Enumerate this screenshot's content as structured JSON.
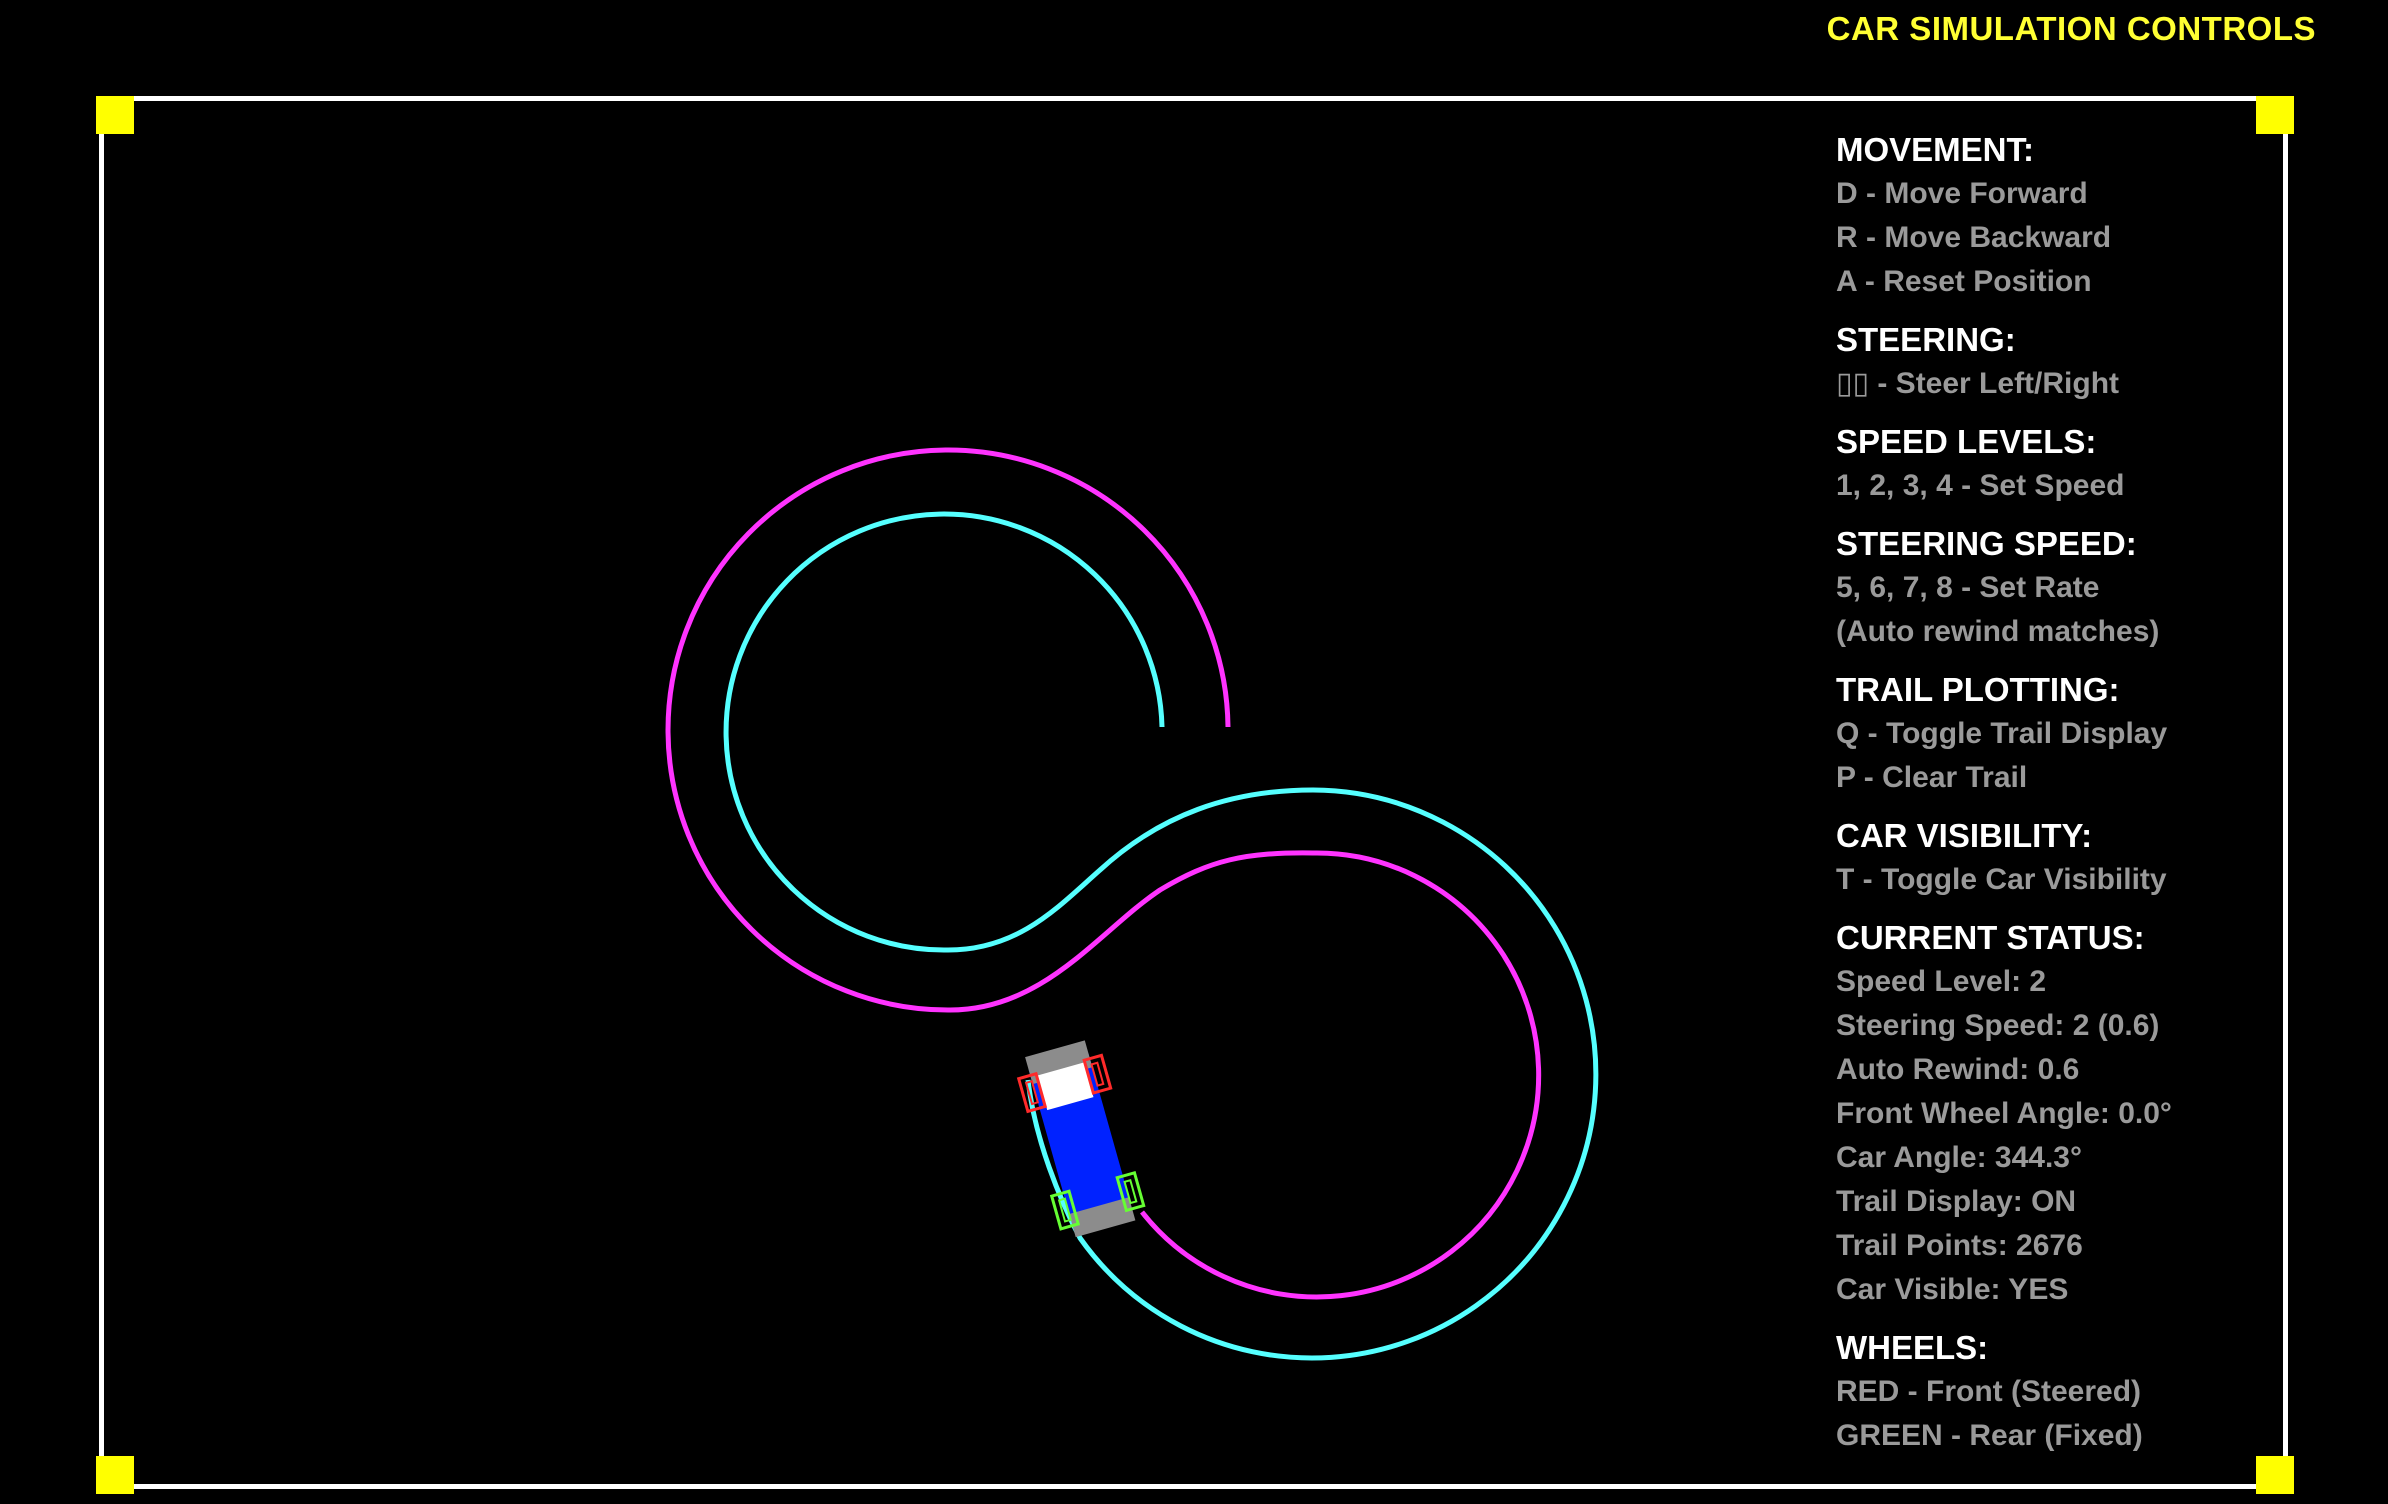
{
  "title": "CAR SIMULATION CONTROLS",
  "colors": {
    "background": "#000000",
    "title": "#ffff33",
    "border": "#ffffff",
    "corner_markers": "#ffff00",
    "heading": "#ffffff",
    "info_text": "#9a9a9a",
    "front_trail": "#ff33ff",
    "rear_trail": "#55ffff",
    "car_body": "#0022ff",
    "car_bumper": "#8c8c8c",
    "windshield": "#ffffff",
    "front_wheels": "#ff2a2a",
    "rear_wheels": "#66ff33"
  },
  "sections": [
    {
      "heading": "MOVEMENT:",
      "lines": [
        "D - Move Forward",
        "R - Move Backward",
        "A - Reset Position"
      ]
    },
    {
      "heading": "STEERING:",
      "lines": [
        "▯▯ - Steer Left/Right"
      ]
    },
    {
      "heading": "SPEED LEVELS:",
      "lines": [
        "1, 2, 3, 4 - Set Speed"
      ]
    },
    {
      "heading": "STEERING SPEED:",
      "lines": [
        "5, 6, 7, 8 - Set Rate",
        "(Auto rewind matches)"
      ]
    },
    {
      "heading": "TRAIL PLOTTING:",
      "lines": [
        "Q - Toggle Trail Display",
        "P - Clear Trail"
      ]
    },
    {
      "heading": "CAR VISIBILITY:",
      "lines": [
        "T - Toggle Car Visibility"
      ]
    },
    {
      "heading": "CURRENT STATUS:",
      "lines": [
        "Speed Level: 2",
        "Steering Speed: 2 (0.6)",
        "Auto Rewind: 0.6",
        "Front Wheel Angle: 0.0°",
        "Car Angle: 344.3°",
        "Trail Display: ON",
        "Trail Points: 2676",
        "Car Visible: YES"
      ]
    },
    {
      "heading": "WHEELS:",
      "lines": [
        "RED - Front (Steered)",
        "GREEN - Rear (Fixed)"
      ]
    }
  ],
  "car": {
    "angle_deg": 344.3,
    "front_wheel_angle_deg": 0.0,
    "visible": true
  }
}
